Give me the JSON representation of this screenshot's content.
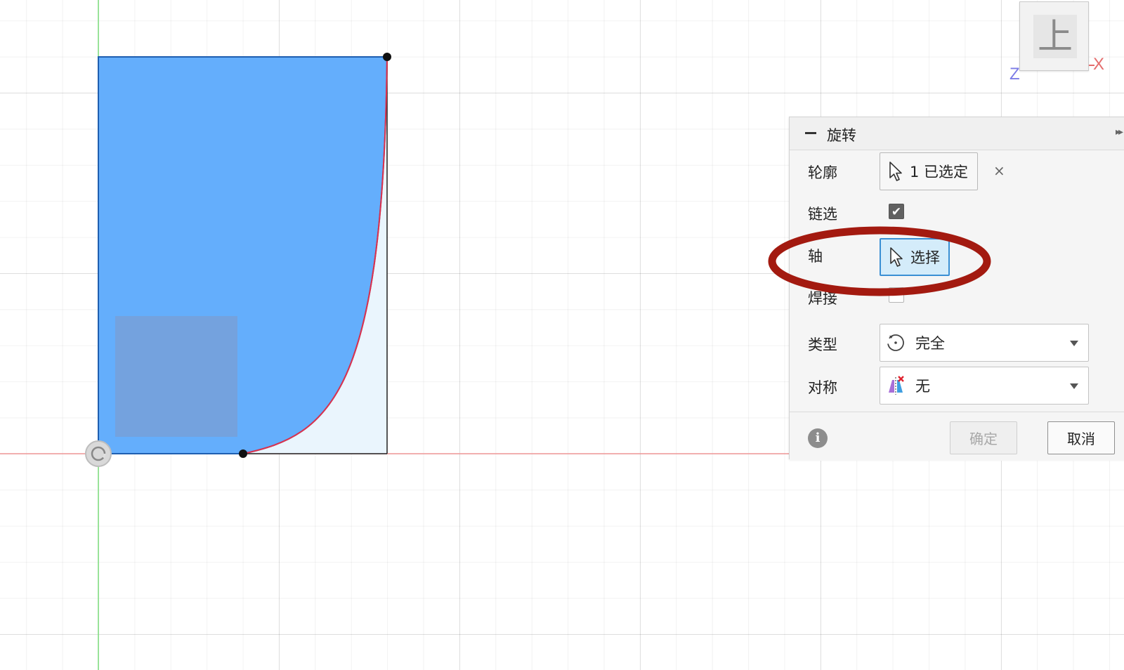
{
  "viewcube": {
    "face_label": "上",
    "axis_x": "X",
    "axis_z": "Z"
  },
  "panel": {
    "title": "旋转",
    "rows": {
      "profile": {
        "label": "轮廓",
        "value": "1 已选定",
        "clear": "×"
      },
      "chain": {
        "label": "链选",
        "checked": true,
        "check_mark": "✔"
      },
      "axis": {
        "label": "轴",
        "value": "选择",
        "state": "active"
      },
      "weld": {
        "label": "焊接",
        "checked": false
      },
      "type": {
        "label": "类型",
        "value": "完全"
      },
      "symmetric": {
        "label": "对称",
        "value": "无"
      }
    },
    "footer": {
      "info": "i",
      "ok": "确定",
      "cancel": "取消"
    }
  },
  "colors": {
    "profile_fill": "#64aefc",
    "curve": "#e0314b",
    "highlight_ring": "#a31a10",
    "active_button": "#d4ecfa"
  },
  "icons": [
    "cursor-arrow-icon",
    "close-icon",
    "check-icon",
    "revolve-full-icon",
    "symmetry-icon",
    "info-icon",
    "collapse-icon",
    "expand-icon"
  ]
}
